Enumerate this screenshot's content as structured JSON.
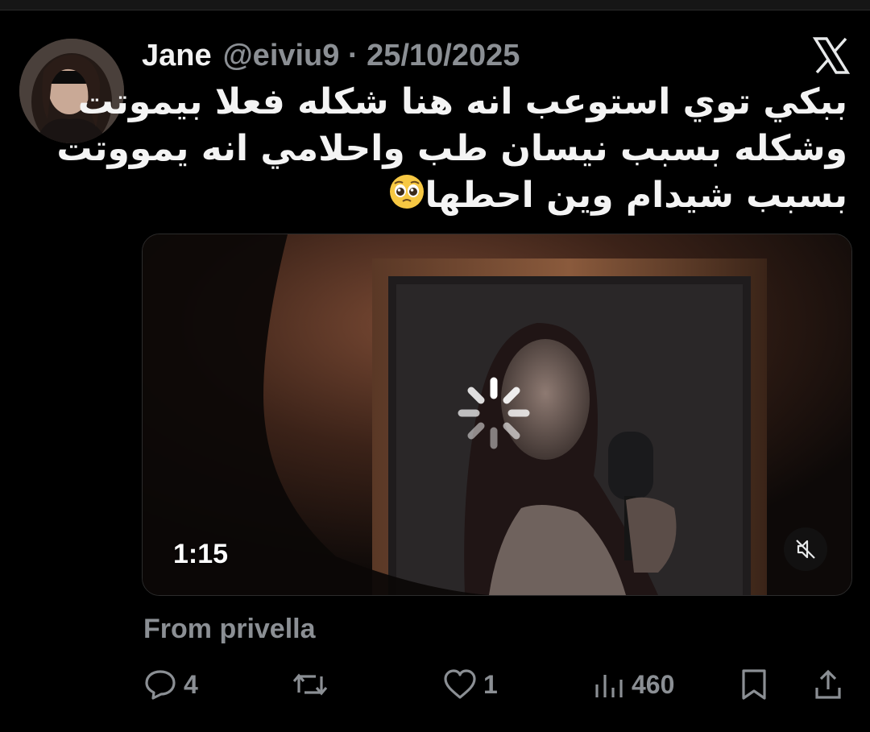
{
  "tweet": {
    "author_name": "Jane",
    "handle_date": "@eiviu9 · 25/10/2025",
    "lines": [
      "ببكي توي استوعب انه هنا شكله فعلا بيموتت",
      "وشكله بسبب نيسان طب واحلامي انه يمووتت",
      "بسبب شيدام وين احطها"
    ],
    "emoji_icon": "pleading-face-emoji"
  },
  "video": {
    "duration": "1:15",
    "mute_icon": "speaker-muted-icon",
    "loading_icon": "loading-spinner-icon"
  },
  "source": {
    "from_label": "From privella"
  },
  "actions": {
    "replies": "4",
    "reposts": "",
    "likes": "1",
    "views": "460"
  },
  "colors": {
    "background": "#000000",
    "muted_text": "#8b8f94",
    "primary_text": "#e7e9ea"
  }
}
